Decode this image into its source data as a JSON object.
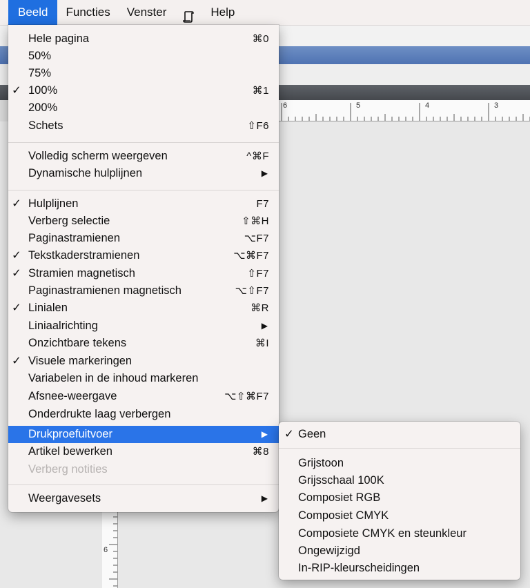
{
  "menubar": {
    "items": [
      {
        "label": "Beeld"
      },
      {
        "label": "Functies"
      },
      {
        "label": "Venster"
      },
      {
        "label": "Help"
      }
    ],
    "script_icon": "script-icon"
  },
  "ruler": {
    "h_labels": [
      "6",
      "5",
      "4",
      "3"
    ],
    "v_labels": [
      "6"
    ]
  },
  "menu": {
    "items": [
      {
        "label": "Hele pagina",
        "shortcut": "⌘0"
      },
      {
        "label": "50%"
      },
      {
        "label": "75%"
      },
      {
        "label": "100%",
        "check": "✓",
        "shortcut": "⌘1"
      },
      {
        "label": "200%"
      },
      {
        "label": "Schets",
        "shortcut": "⇧F6"
      },
      {
        "label": "Volledig scherm weergeven",
        "shortcut": "^⌘F"
      },
      {
        "label": "Dynamische hulplijnen",
        "submenu_arrow": "▶"
      },
      {
        "label": "Hulplijnen",
        "check": "✓",
        "shortcut": "F7"
      },
      {
        "label": "Verberg selectie",
        "shortcut": "⇧⌘H"
      },
      {
        "label": "Paginastramienen",
        "shortcut": "⌥F7"
      },
      {
        "label": "Tekstkaderstramienen",
        "check": "✓",
        "shortcut": "⌥⌘F7"
      },
      {
        "label": "Stramien magnetisch",
        "check": "✓",
        "shortcut": "⇧F7"
      },
      {
        "label": "Paginastramienen magnetisch",
        "shortcut": "⌥⇧F7"
      },
      {
        "label": "Linialen",
        "check": "✓",
        "shortcut": "⌘R"
      },
      {
        "label": "Liniaalrichting",
        "submenu_arrow": "▶"
      },
      {
        "label": "Onzichtbare tekens",
        "shortcut": "⌘I"
      },
      {
        "label": "Visuele markeringen",
        "check": "✓"
      },
      {
        "label": "Variabelen in de inhoud markeren"
      },
      {
        "label": "Afsnee-weergave",
        "shortcut": "⌥⇧⌘F7"
      },
      {
        "label": "Onderdrukte laag verbergen"
      },
      {
        "label": "Drukproefuitvoer",
        "submenu_arrow": "▶",
        "highlighted": true
      },
      {
        "label": "Artikel bewerken",
        "shortcut": "⌘8"
      },
      {
        "label": "Verberg notities",
        "disabled": true
      },
      {
        "label": "Weergavesets",
        "submenu_arrow": "▶"
      }
    ]
  },
  "submenu": {
    "items": [
      {
        "label": "Geen",
        "check": "✓"
      },
      {
        "label": "Grijstoon"
      },
      {
        "label": "Grijsschaal 100K"
      },
      {
        "label": "Composiet RGB"
      },
      {
        "label": "Composiet CMYK"
      },
      {
        "label": "Composiete CMYK en steunkleur"
      },
      {
        "label": "Ongewijzigd"
      },
      {
        "label": "In-RIP-kleurscheidingen"
      }
    ]
  },
  "colors": {
    "highlight": "#2a74e8",
    "menu_bg": "#f6f2f1"
  }
}
